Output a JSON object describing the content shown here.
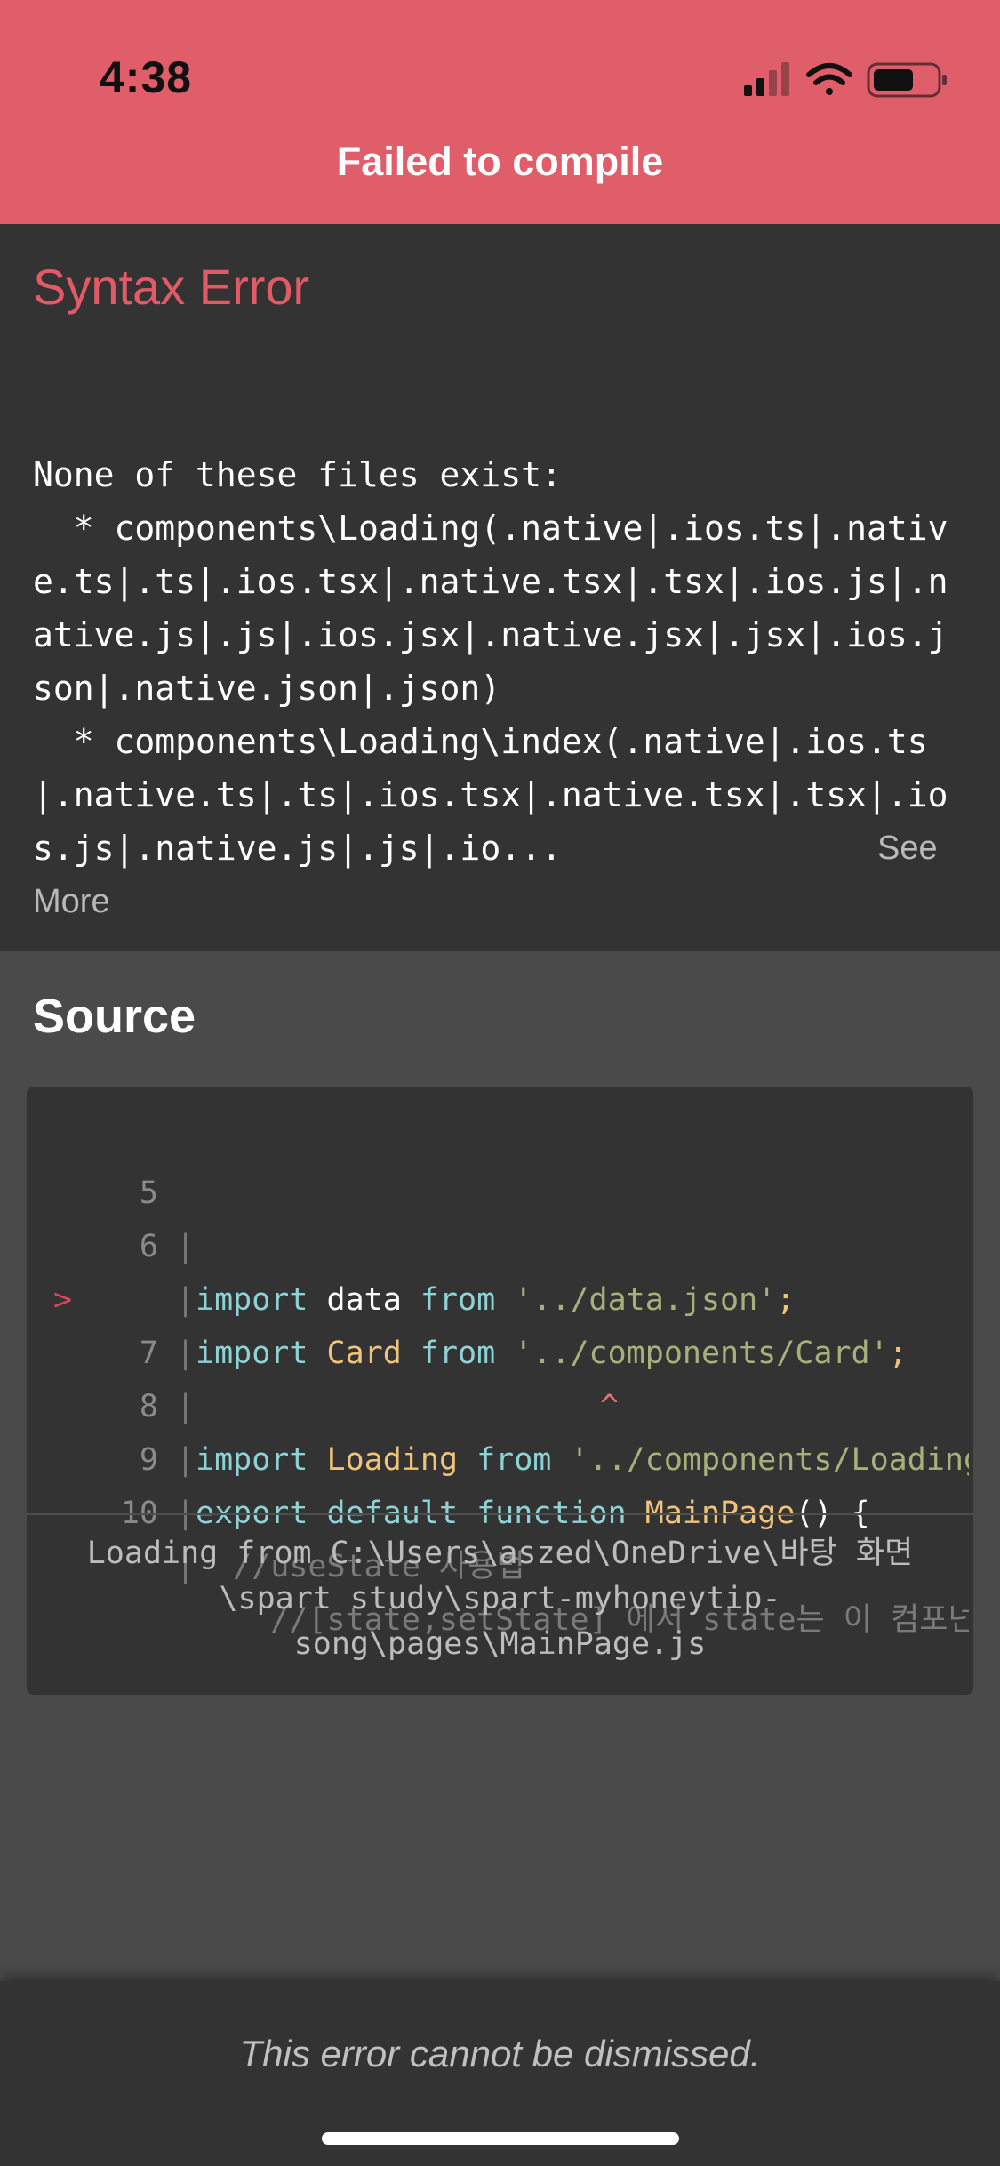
{
  "status_bar": {
    "time": "4:38"
  },
  "header": {
    "title": "Failed to compile"
  },
  "error": {
    "title": "Syntax Error",
    "message": "None of these files exist:\n  * components\\Loading(.native|.ios.ts|.native.ts|.ts|.ios.tsx|.native.tsx|.tsx|.ios.js|.native.js|.js|.ios.jsx|.native.jsx|.jsx|.ios.json|.native.json|.json)\n  * components\\Loading\\index(.native|.ios.ts|.native.ts|.ts|.ios.tsx|.native.tsx|.tsx|.ios.js|.native.js|.js|.io...",
    "see_more_a": "See",
    "see_more_b": "More"
  },
  "source": {
    "heading": "Source",
    "lines": [
      {
        "num": "5",
        "marker": "",
        "t1": "import",
        "t2": " data ",
        "t3": "from",
        "t4": " '../data.json'",
        "t5": ";"
      },
      {
        "num": "6",
        "marker": "",
        "t1": "import",
        "t2": " Card ",
        "t3": "from",
        "t4": " '../components/Card'",
        "t5": ";"
      },
      {
        "num": "7",
        "marker": ">",
        "t1": "import",
        "t2": " Loading ",
        "t3": "from",
        "t4": " '../components/Loading'",
        "t5": ""
      },
      {
        "num": "",
        "marker": "",
        "caret": "^"
      },
      {
        "num": "8",
        "marker": "",
        "t1": "export",
        "t2": " ",
        "t3": "default",
        "t4": " function ",
        "t5": "MainPage",
        "t6": "() {"
      },
      {
        "num": "9",
        "marker": "",
        "comment": "  //useState 사용법"
      },
      {
        "num": "10",
        "marker": "",
        "comment": "    //[state,setState] 에서 state는 이 컴포넌트에서 관리될"
      }
    ],
    "file_path_1": "Loading from C:\\Users\\aszed\\OneDrive\\바탕 화면",
    "file_path_2": "\\spart study\\spart-myhoneytip-",
    "file_path_3": "song\\pages\\MainPage.js"
  },
  "footer": {
    "text": "This error cannot be dismissed."
  }
}
